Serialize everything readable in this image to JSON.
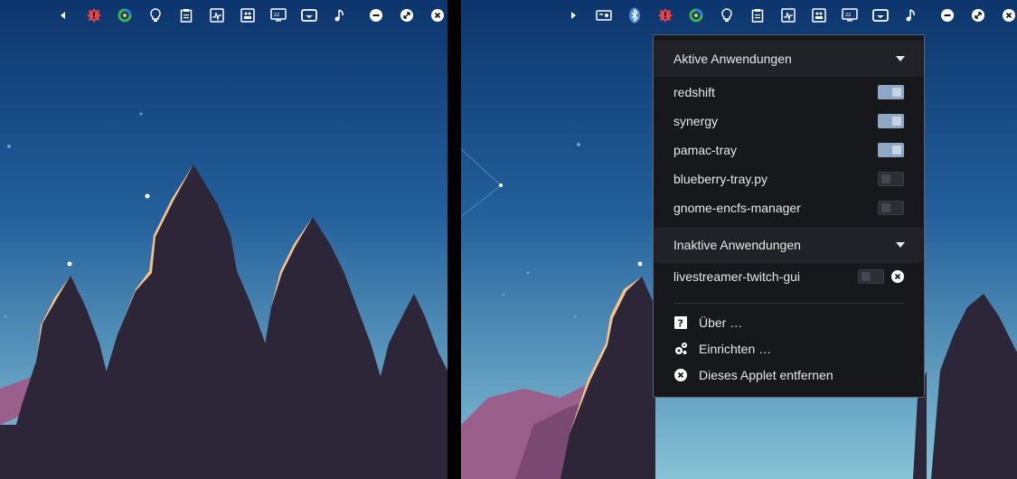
{
  "left_panel": {
    "icons": [
      "arrow-left-icon",
      "bug-alert-icon",
      "colorful-refresh-icon",
      "lightbulb-icon",
      "clipboard-icon",
      "system-monitor-icon",
      "cpu-chip-icon",
      "sleep-display-icon",
      "network-icon",
      "music-note-icon",
      "minimize-icon",
      "resize-icon",
      "close-icon"
    ]
  },
  "right_panel": {
    "icons": [
      "arrow-right-icon",
      "drive-icon",
      "bluetooth-icon",
      "bug-alert-icon",
      "colorful-refresh-icon",
      "lightbulb-icon",
      "clipboard-icon",
      "system-monitor-icon",
      "cpu-chip-icon",
      "sleep-display-icon",
      "network-icon",
      "music-note-icon",
      "minimize-icon",
      "resize-icon",
      "close-icon"
    ]
  },
  "menu": {
    "active_header": "Aktive Anwendungen",
    "active_apps": [
      {
        "name": "redshift",
        "enabled": true
      },
      {
        "name": "synergy",
        "enabled": true
      },
      {
        "name": "pamac-tray",
        "enabled": true
      },
      {
        "name": "blueberry-tray.py",
        "enabled": false
      },
      {
        "name": "gnome-encfs-manager",
        "enabled": false
      }
    ],
    "inactive_header": "Inaktive Anwendungen",
    "inactive_apps": [
      {
        "name": "livestreamer-twitch-gui",
        "enabled": false
      }
    ],
    "actions": {
      "about": "Über …",
      "configure": "Einrichten …",
      "remove": "Dieses Applet entfernen"
    }
  },
  "colors": {
    "sky_top": "#0f3a73",
    "sky_mid": "#2a6aa3",
    "sky_bottom": "#7cb9d2",
    "tree": "#2d2639",
    "tree_highlight": "#f7c38d",
    "hill": "#9a5f8a",
    "toggle_on": "#8ea7c5",
    "alert_red": "#e8424a",
    "bluetooth_blue": "#4c8ad6"
  }
}
